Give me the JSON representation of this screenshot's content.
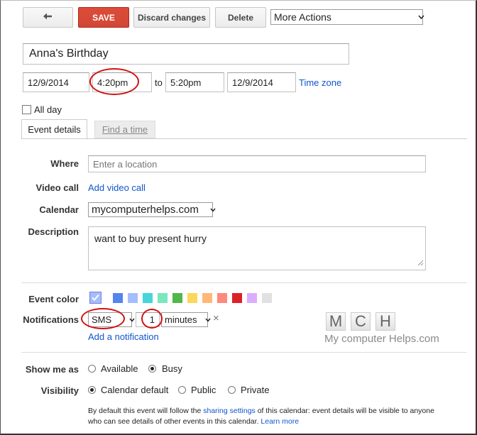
{
  "toolbar": {
    "back_icon": "back-arrow-icon",
    "save_label": "SAVE",
    "discard_label": "Discard changes",
    "delete_label": "Delete",
    "more_actions_label": "More Actions"
  },
  "event": {
    "title": "Anna's Birthday",
    "start_date": "12/9/2014",
    "start_time": "4:20pm",
    "to_label": "to",
    "end_time": "5:20pm",
    "end_date": "12/9/2014",
    "timezone_link": "Time zone",
    "all_day_label": "All day",
    "all_day_checked": false
  },
  "tabs": [
    {
      "label": "Event details",
      "active": true
    },
    {
      "label": "Find a time",
      "active": false
    }
  ],
  "details": {
    "where_label": "Where",
    "where_placeholder": "Enter a location",
    "video_label": "Video call",
    "video_link": "Add video call",
    "calendar_label": "Calendar",
    "calendar_value": "mycomputerhelps.com",
    "description_label": "Description",
    "description_value": "want to buy present hurry",
    "color_label": "Event color",
    "colors": [
      "#a4bdfc",
      "#5484ed",
      "#a4bdfc",
      "#46d6db",
      "#7ae7bf",
      "#51b749",
      "#fbd75b",
      "#ffb878",
      "#ff887c",
      "#dc2127",
      "#dbadff",
      "#e1e1e1"
    ],
    "notifications_label": "Notifications",
    "notification_method": "SMS",
    "notification_amount": "1",
    "notification_unit": "minutes",
    "remove_notification": "×",
    "add_notification": "Add a notification",
    "show_me_as_label": "Show me as",
    "show_available": "Available",
    "show_busy": "Busy",
    "show_selected": "Busy",
    "visibility_label": "Visibility",
    "visibility_default": "Calendar default",
    "visibility_public": "Public",
    "visibility_private": "Private",
    "visibility_selected": "Calendar default",
    "note_part1": "By default this event will follow the ",
    "note_link1": "sharing settings",
    "note_part2": " of this calendar: event details will be visible to anyone",
    "note_part3": "who can see details of other events in this calendar. ",
    "note_link2": "Learn more"
  },
  "watermark": {
    "letters": [
      "M",
      "C",
      "H"
    ],
    "text": "My computer Helps.com"
  },
  "annotation_color": "#d11111"
}
